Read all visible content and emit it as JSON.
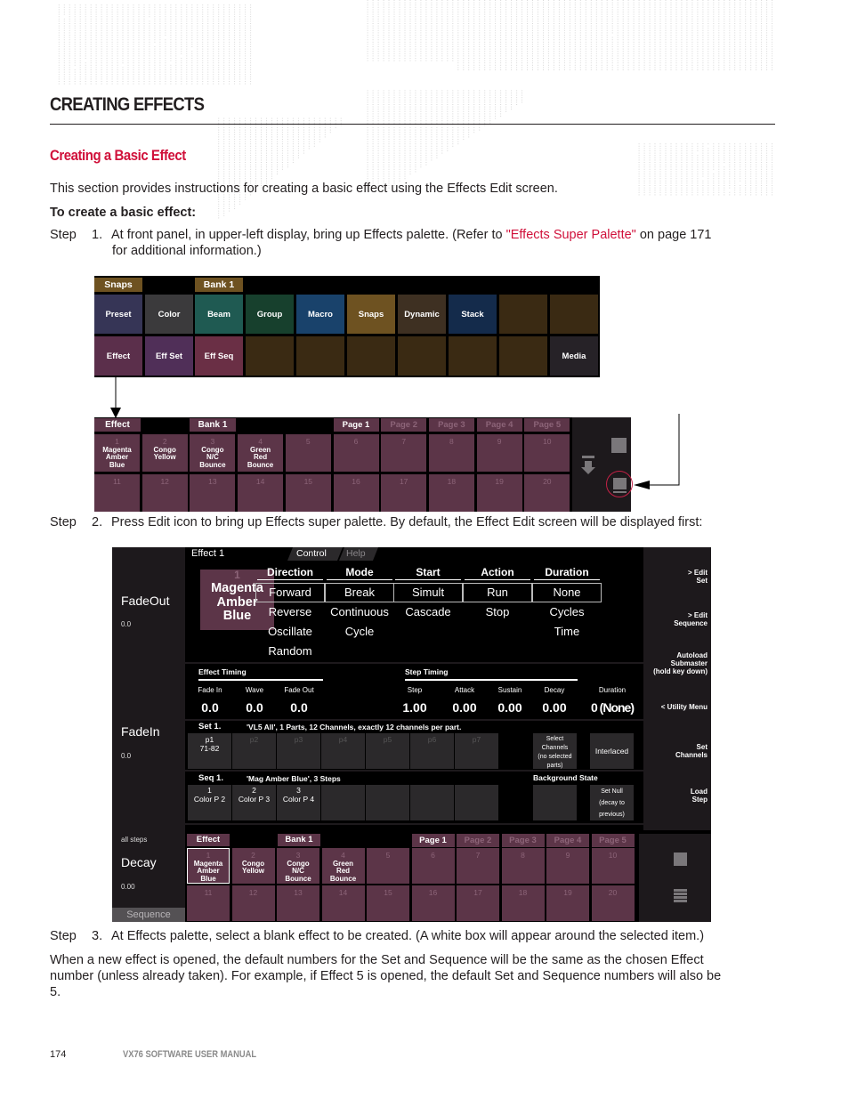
{
  "page": {
    "heading": "CREATING EFFECTS",
    "subheading": "Creating a Basic Effect",
    "intro": "This section provides instructions for creating a basic effect using the Effects Edit screen.",
    "procedure_title": "To create a basic effect:",
    "steps": [
      {
        "label": "Step",
        "num": "1.",
        "text_before": "At front panel, in upper-left display, bring up Effects palette. (Refer to ",
        "link": "\"Effects Super Palette\"",
        "text_after": " on page 171",
        "text_line2": "for additional information.)"
      },
      {
        "label": "Step",
        "num": "2.",
        "text": "Press Edit icon to bring up Effects super palette. By default, the Effect Edit screen will be displayed first:"
      },
      {
        "label": "Step",
        "num": "3.",
        "text": "At Effects palette, select a blank effect to be created. (A white box will appear around the selected item.)"
      }
    ],
    "note_lines": [
      "When a new effect is opened, the default numbers for the Set and Sequence will be the same as the chosen Effect",
      "number (unless already taken). For example, if Effect 5 is opened, the default Set and Sequence numbers will also be",
      "5."
    ],
    "footer": {
      "page_number": "174",
      "manual_title": "VX76 SOFTWARE USER MANUAL"
    },
    "colors": {
      "accent": "#d0103a",
      "text": "#231f20",
      "effect_cell": "#5c3548"
    }
  },
  "palette_main": {
    "tags": [
      "Snaps",
      "Bank 1"
    ],
    "row1": [
      {
        "label": "Preset",
        "color": "#363556"
      },
      {
        "label": "Color",
        "color": "#3b3a3c"
      },
      {
        "label": "Beam",
        "color": "#1f5a52"
      },
      {
        "label": "Group",
        "color": "#17402d"
      },
      {
        "label": "Macro",
        "color": "#19426b"
      },
      {
        "label": "Snaps",
        "color": "#6e5221"
      },
      {
        "label": "Dynamic",
        "color": "#3e3022"
      },
      {
        "label": "Stack",
        "color": "#142b4b"
      },
      {
        "label": "",
        "color": "#3a2a13"
      },
      {
        "label": "",
        "color": "#3a2a13"
      }
    ],
    "row2": [
      {
        "label": "Effect",
        "color": "#5b2f4b"
      },
      {
        "label": "Eff Set",
        "color": "#502f58"
      },
      {
        "label": "Eff Seq",
        "color": "#6a2f45"
      },
      {
        "label": "",
        "color": "#3a2a13"
      },
      {
        "label": "",
        "color": "#3a2a13"
      },
      {
        "label": "",
        "color": "#3a2a13"
      },
      {
        "label": "",
        "color": "#3a2a13"
      },
      {
        "label": "",
        "color": "#3a2a13"
      },
      {
        "label": "",
        "color": "#3a2a13"
      },
      {
        "label": "Media",
        "color": "#262227"
      }
    ]
  },
  "effects_palette": {
    "tags": {
      "type": "Effect",
      "bank": "Bank 1"
    },
    "pages": [
      "Page 1",
      "Page 2",
      "Page 3",
      "Page 4",
      "Page 5"
    ],
    "active_page": "Page 1",
    "cells": [
      {
        "num": "1",
        "name": "Magenta Amber Blue"
      },
      {
        "num": "2",
        "name": "Congo Yellow"
      },
      {
        "num": "3",
        "name": "Congo N/C Bounce"
      },
      {
        "num": "4",
        "name": "Green Red Bounce"
      },
      {
        "num": "5",
        "name": ""
      },
      {
        "num": "6",
        "name": ""
      },
      {
        "num": "7",
        "name": ""
      },
      {
        "num": "8",
        "name": ""
      },
      {
        "num": "9",
        "name": ""
      },
      {
        "num": "10",
        "name": ""
      },
      {
        "num": "11",
        "name": ""
      },
      {
        "num": "12",
        "name": ""
      },
      {
        "num": "13",
        "name": ""
      },
      {
        "num": "14",
        "name": ""
      },
      {
        "num": "15",
        "name": ""
      },
      {
        "num": "16",
        "name": ""
      },
      {
        "num": "17",
        "name": ""
      },
      {
        "num": "18",
        "name": ""
      },
      {
        "num": "19",
        "name": ""
      },
      {
        "num": "20",
        "name": ""
      }
    ],
    "side_icons": [
      "square-icon",
      "load-arrow-icon",
      "edit-icon"
    ]
  },
  "edit_screen": {
    "title": "Effect 1",
    "tabs": [
      "Control",
      "Help"
    ],
    "selected_effect": {
      "num": "1",
      "name_lines": [
        "Magenta",
        "Amber",
        "Blue"
      ]
    },
    "left": {
      "fadeout_label": "FadeOut",
      "fadeout_value": "0.0",
      "fadein_label": "FadeIn",
      "fadein_value": "0.0",
      "scope": "all steps",
      "decay_label": "Decay",
      "decay_value": "0.00",
      "sequence_button": "Sequence"
    },
    "columns": [
      {
        "header": "Direction",
        "selected": "Forward",
        "options": [
          "Reverse",
          "Oscillate",
          "Random"
        ]
      },
      {
        "header": "Mode",
        "selected": "Break",
        "options": [
          "Continuous",
          "Cycle"
        ]
      },
      {
        "header": "Start",
        "selected": "Simult",
        "options": [
          "Cascade"
        ]
      },
      {
        "header": "Action",
        "selected": "Run",
        "options": [
          "Stop"
        ]
      },
      {
        "header": "Duration",
        "selected": "None",
        "options": [
          "Cycles",
          "Time"
        ]
      }
    ],
    "effect_timing": {
      "title": "Effect Timing",
      "fields": [
        {
          "label": "Fade In",
          "value": "0.0"
        },
        {
          "label": "Wave",
          "value": "0.0"
        },
        {
          "label": "Fade Out",
          "value": "0.0"
        }
      ]
    },
    "step_timing": {
      "title": "Step Timing",
      "fields": [
        {
          "label": "Step",
          "value": "1.00"
        },
        {
          "label": "Attack",
          "value": "0.00"
        },
        {
          "label": "Sustain",
          "value": "0.00"
        },
        {
          "label": "Decay",
          "value": "0.00"
        },
        {
          "label": "Duration",
          "value": "0 (None)"
        }
      ]
    },
    "set": {
      "label": "Set 1.",
      "desc": "'VL5 All', 1 Parts, 12 Channels, exactly 12 channels per part.",
      "parts": [
        {
          "name": "p1",
          "range": "71-82"
        },
        {
          "name": "p2",
          "range": ""
        },
        {
          "name": "p3",
          "range": ""
        },
        {
          "name": "p4",
          "range": ""
        },
        {
          "name": "p5",
          "range": ""
        },
        {
          "name": "p6",
          "range": ""
        },
        {
          "name": "p7",
          "range": ""
        }
      ],
      "select_channels": [
        "Select",
        "Channels",
        "(no selected",
        "parts)"
      ],
      "interlaced": "Interlaced"
    },
    "sequence": {
      "label": "Seq 1.",
      "desc": "'Mag Amber Blue', 3 Steps",
      "steps": [
        {
          "num": "1",
          "name": "Color P 2"
        },
        {
          "num": "2",
          "name": "Color P 3"
        },
        {
          "num": "3",
          "name": "Color P 4"
        }
      ],
      "background_state_label": "Background State",
      "set_null": [
        "Set Null",
        "(decay to",
        "previous)"
      ]
    },
    "right_menu": [
      {
        "lines": [
          "> Edit",
          "Set"
        ]
      },
      {
        "lines": [
          "> Edit",
          "Sequence"
        ]
      },
      {
        "lines": [
          "Autoload",
          "Submaster",
          "(hold key down)"
        ]
      },
      {
        "lines": [
          "< Utility Menu"
        ]
      },
      {
        "lines": [
          "Set",
          "Channels"
        ]
      },
      {
        "lines": [
          "Load",
          "Step"
        ]
      }
    ],
    "bottom_palette": {
      "tags": {
        "type": "Effect",
        "bank": "Bank 1"
      },
      "pages": [
        "Page 1",
        "Page 2",
        "Page 3",
        "Page 4",
        "Page 5"
      ],
      "selected_cell": "1"
    }
  }
}
